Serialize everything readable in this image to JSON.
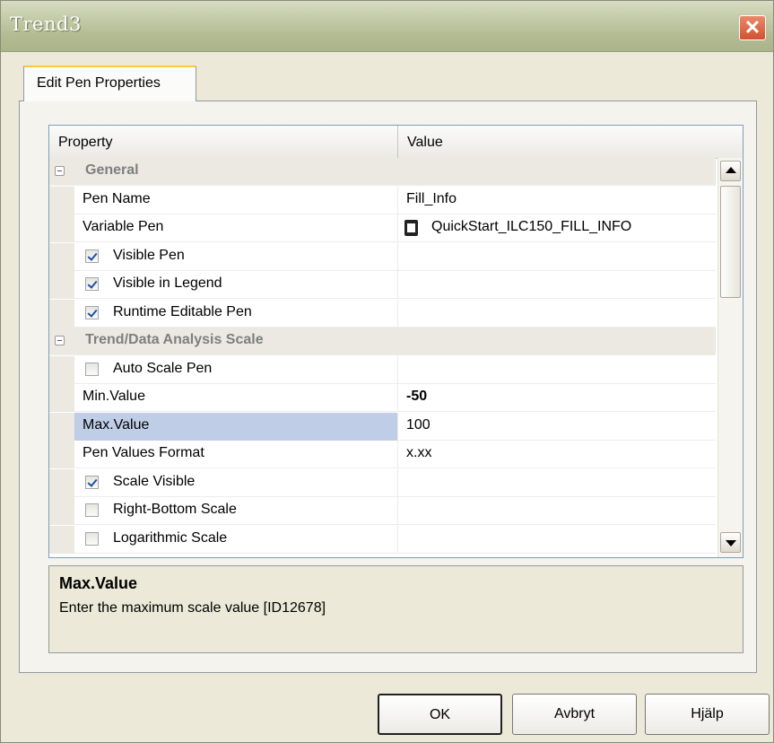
{
  "window": {
    "title": "Trend3",
    "close_symbol": "✕"
  },
  "tabs": [
    {
      "label": "Edit Pen Properties"
    }
  ],
  "grid": {
    "header": {
      "property": "Property",
      "value": "Value"
    },
    "rows": [
      {
        "type": "category",
        "label": "General"
      },
      {
        "type": "prop",
        "label": "Pen Name",
        "value": "Fill_Info"
      },
      {
        "type": "prop",
        "label": "Variable Pen",
        "value": "QuickStart_ILC150_FILL_INFO",
        "icon": "variable-icon"
      },
      {
        "type": "check",
        "label": "Visible Pen",
        "checked": true
      },
      {
        "type": "check",
        "label": "Visible in Legend",
        "checked": true
      },
      {
        "type": "check",
        "label": "Runtime Editable Pen",
        "checked": true
      },
      {
        "type": "category",
        "label": "Trend/Data Analysis Scale"
      },
      {
        "type": "check",
        "label": "Auto Scale Pen",
        "checked": false
      },
      {
        "type": "prop",
        "label": "Min.Value",
        "value": "-50",
        "bold": true
      },
      {
        "type": "prop",
        "label": "Max.Value",
        "value": "100",
        "selected": true
      },
      {
        "type": "prop",
        "label": "Pen Values Format",
        "value": "x.xx"
      },
      {
        "type": "check",
        "label": "Scale Visible",
        "checked": true
      },
      {
        "type": "check",
        "label": "Right-Bottom Scale",
        "checked": false
      },
      {
        "type": "check",
        "label": "Logarithmic Scale",
        "checked": false
      }
    ]
  },
  "help": {
    "title": "Max.Value",
    "description": "Enter the maximum scale value [ID12678]"
  },
  "buttons": {
    "ok": "OK",
    "cancel": "Avbryt",
    "help": "Hjälp"
  },
  "colors": {
    "selection": "#bfcde6",
    "checkmark": "#1e4fa8",
    "close": "#d3502e"
  }
}
